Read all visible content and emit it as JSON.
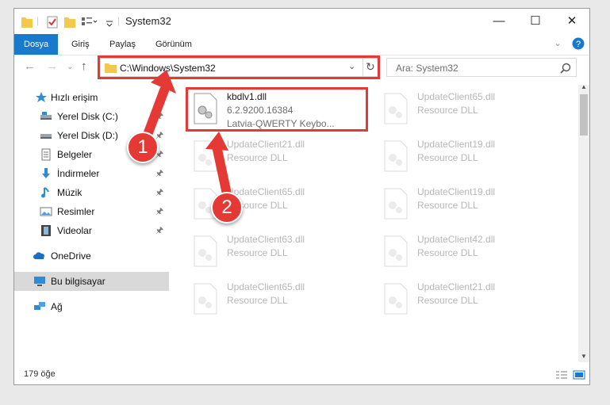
{
  "window": {
    "title": "System32"
  },
  "ribbon": {
    "tabs": [
      "Dosya",
      "Giriş",
      "Paylaş",
      "Görünüm"
    ]
  },
  "address": {
    "path": "C:\\Windows\\System32",
    "search_placeholder": "Ara: System32"
  },
  "nav": {
    "items": [
      {
        "label": "Hızlı erişim",
        "icon": "star-icon"
      },
      {
        "label": "Yerel Disk (C:)",
        "icon": "drive-icon",
        "pinned": true
      },
      {
        "label": "Yerel Disk (D:)",
        "icon": "drive-icon",
        "pinned": true
      },
      {
        "label": "Belgeler",
        "icon": "documents-icon",
        "pinned": true
      },
      {
        "label": "İndirmeler",
        "icon": "download-icon",
        "pinned": true
      },
      {
        "label": "Müzik",
        "icon": "music-icon",
        "pinned": true
      },
      {
        "label": "Resimler",
        "icon": "pictures-icon",
        "pinned": true
      },
      {
        "label": "Videolar",
        "icon": "videos-icon",
        "pinned": true
      },
      {
        "label": "OneDrive",
        "icon": "cloud-icon"
      },
      {
        "label": "Bu bilgisayar",
        "icon": "computer-icon"
      },
      {
        "label": "Ağ",
        "icon": "network-icon"
      }
    ]
  },
  "files": [
    {
      "name": "kbdlv1.dll",
      "type": "6.2.9200.16384",
      "desc": "Latvia-QWERTY Keybo..."
    },
    {
      "name": "UpdateClient65.dll",
      "type": "Resource DLL"
    },
    {
      "name": "UpdateClient21.dll",
      "type": "Resource DLL"
    },
    {
      "name": "UpdateClient19.dll",
      "type": "Resource DLL"
    },
    {
      "name": "UpdateClient65.dll",
      "type": "Resource DLL"
    },
    {
      "name": "UpdateClient19.dll",
      "type": "Resource DLL"
    },
    {
      "name": "UpdateClient63.dll",
      "type": "Resource DLL"
    },
    {
      "name": "UpdateClient42.dll",
      "type": "Resource DLL"
    },
    {
      "name": "UpdateClient65.dll",
      "type": "Resource DLL"
    },
    {
      "name": "UpdateClient21.dll",
      "type": "Resource DLL"
    }
  ],
  "status": {
    "count": "179 öğe"
  },
  "annotations": {
    "callout1": "1",
    "callout2": "2"
  },
  "colors": {
    "accent": "#1979ca",
    "highlight": "#e53935"
  }
}
